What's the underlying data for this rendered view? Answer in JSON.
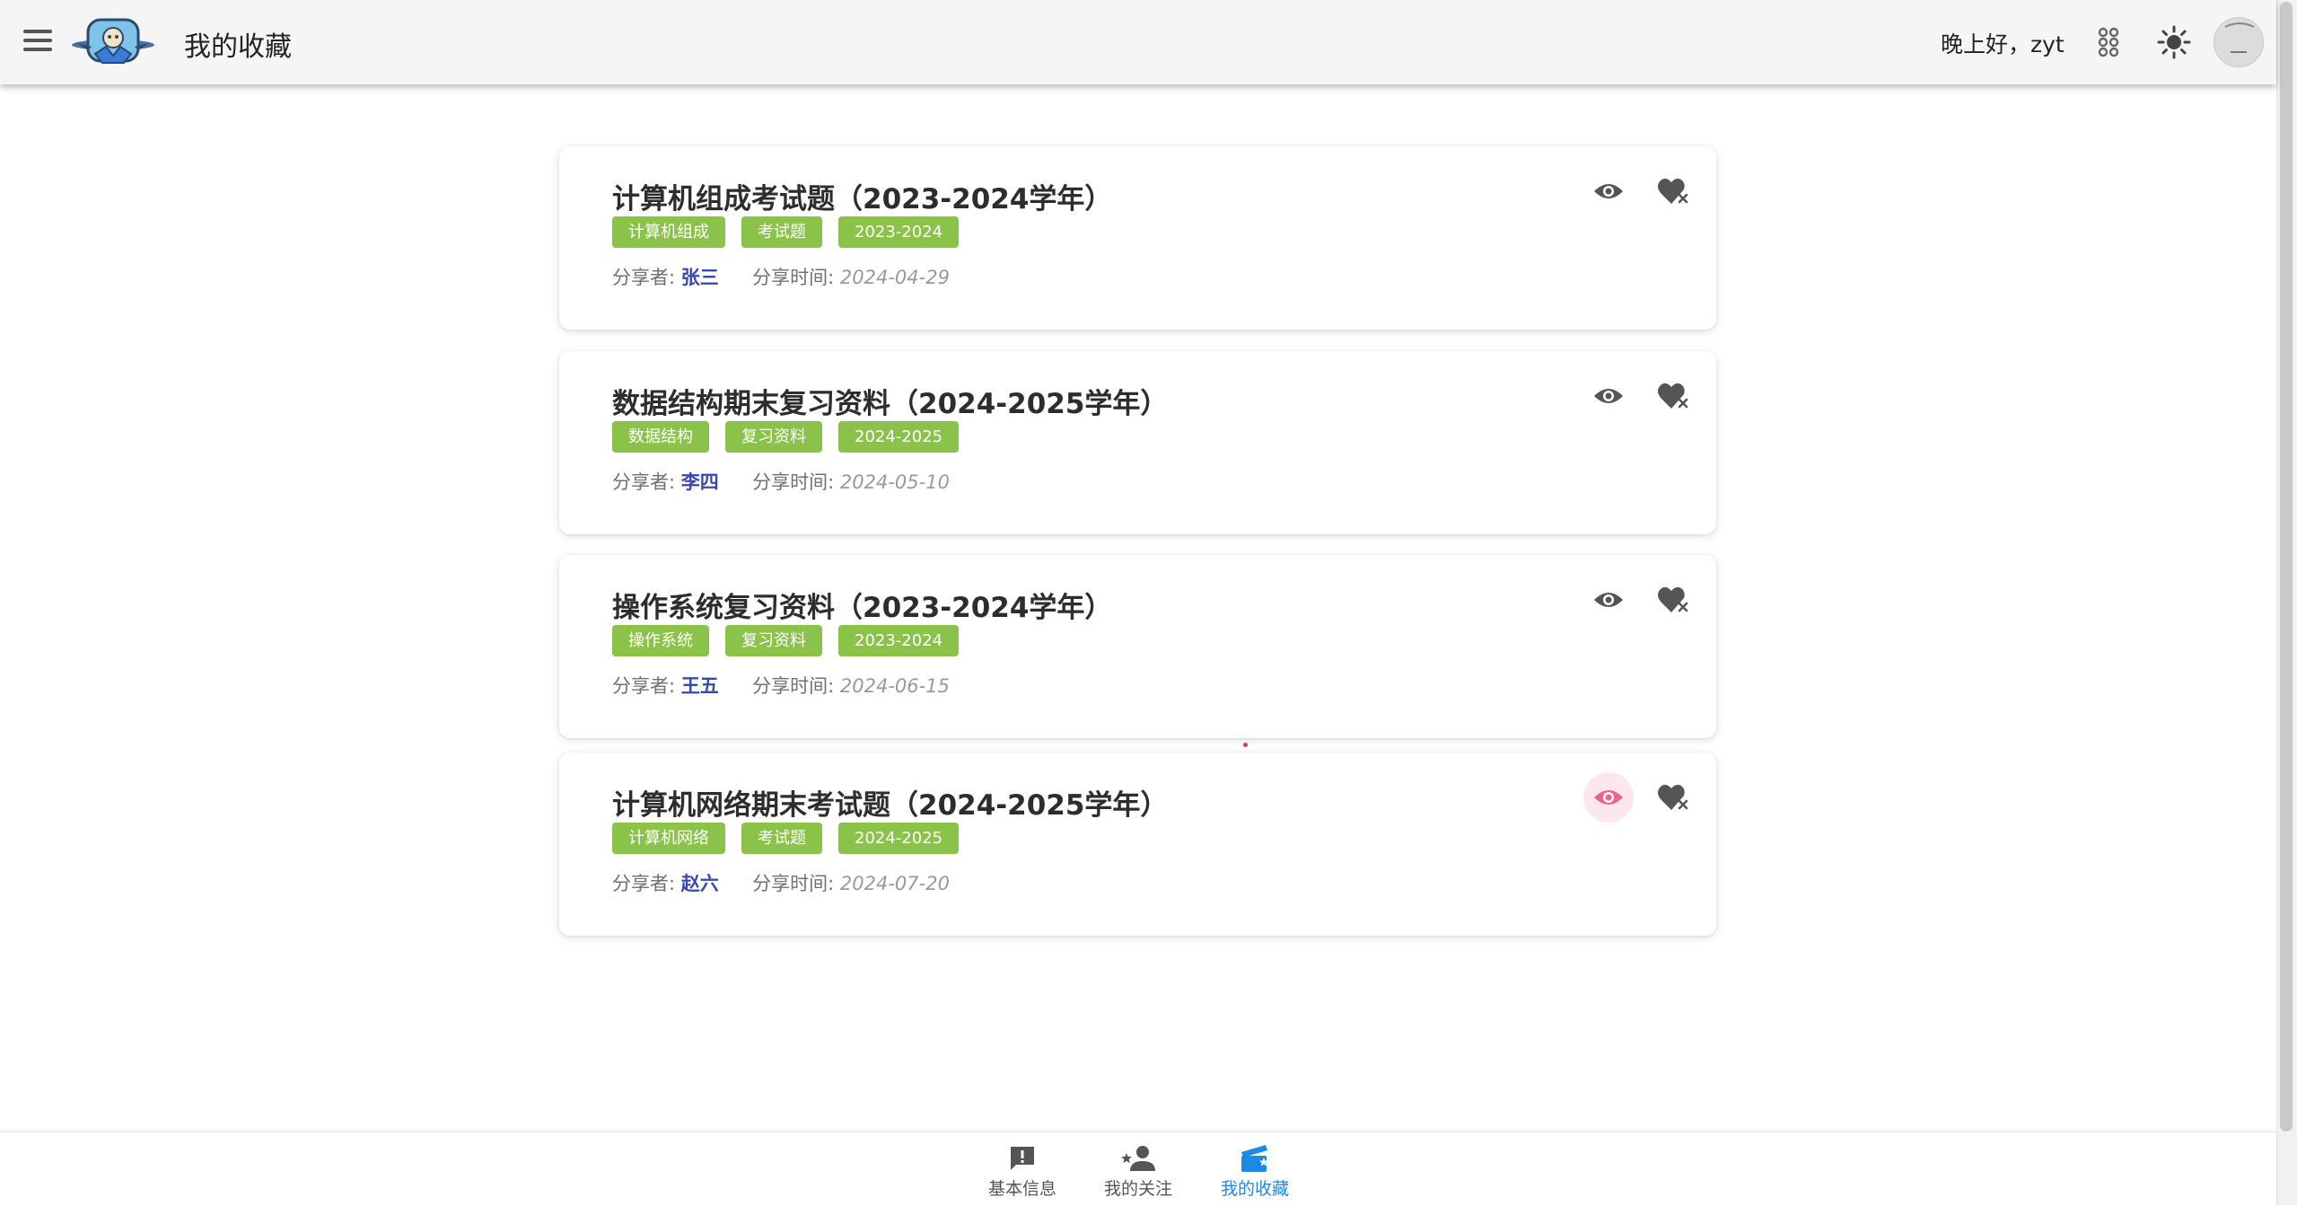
{
  "header": {
    "title": "我的收藏",
    "greeting": "晚上好，zyt",
    "icons": [
      "menu-icon",
      "app-logo",
      "plugin-icon",
      "brightness-icon",
      "user-avatar"
    ]
  },
  "cards": [
    {
      "title": "计算机组成考试题（2023-2024学年）",
      "tags": [
        "计算机组成",
        "考试题",
        "2023-2024"
      ],
      "sharer_label": "分享者:",
      "sharer": "张三",
      "time_label": "分享时间:",
      "time": "2024-04-29"
    },
    {
      "title": "数据结构期末复习资料（2024-2025学年）",
      "tags": [
        "数据结构",
        "复习资料",
        "2024-2025"
      ],
      "sharer_label": "分享者:",
      "sharer": "李四",
      "time_label": "分享时间:",
      "time": "2024-05-10"
    },
    {
      "title": "操作系统复习资料（2023-2024学年）",
      "tags": [
        "操作系统",
        "复习资料",
        "2023-2024"
      ],
      "sharer_label": "分享者:",
      "sharer": "王五",
      "time_label": "分享时间:",
      "time": "2024-06-15"
    },
    {
      "title": "计算机网络期末考试题（2024-2025学年）",
      "tags": [
        "计算机网络",
        "考试题",
        "2024-2025"
      ],
      "sharer_label": "分享者:",
      "sharer": "赵六",
      "time_label": "分享时间:",
      "time": "2024-07-20"
    }
  ],
  "bottom_nav": [
    {
      "label": "基本信息",
      "icon": "feedback-icon",
      "active": false
    },
    {
      "label": "我的关注",
      "icon": "follow-person-icon",
      "active": false
    },
    {
      "label": "我的收藏",
      "icon": "favorites-clapper-icon",
      "active": true
    }
  ],
  "colors": {
    "tag": "#8bc34a",
    "sharer": "#3949ab",
    "active_nav": "#1e88e5",
    "active_view": "#f06292",
    "appbar": "#f5f5f5"
  }
}
